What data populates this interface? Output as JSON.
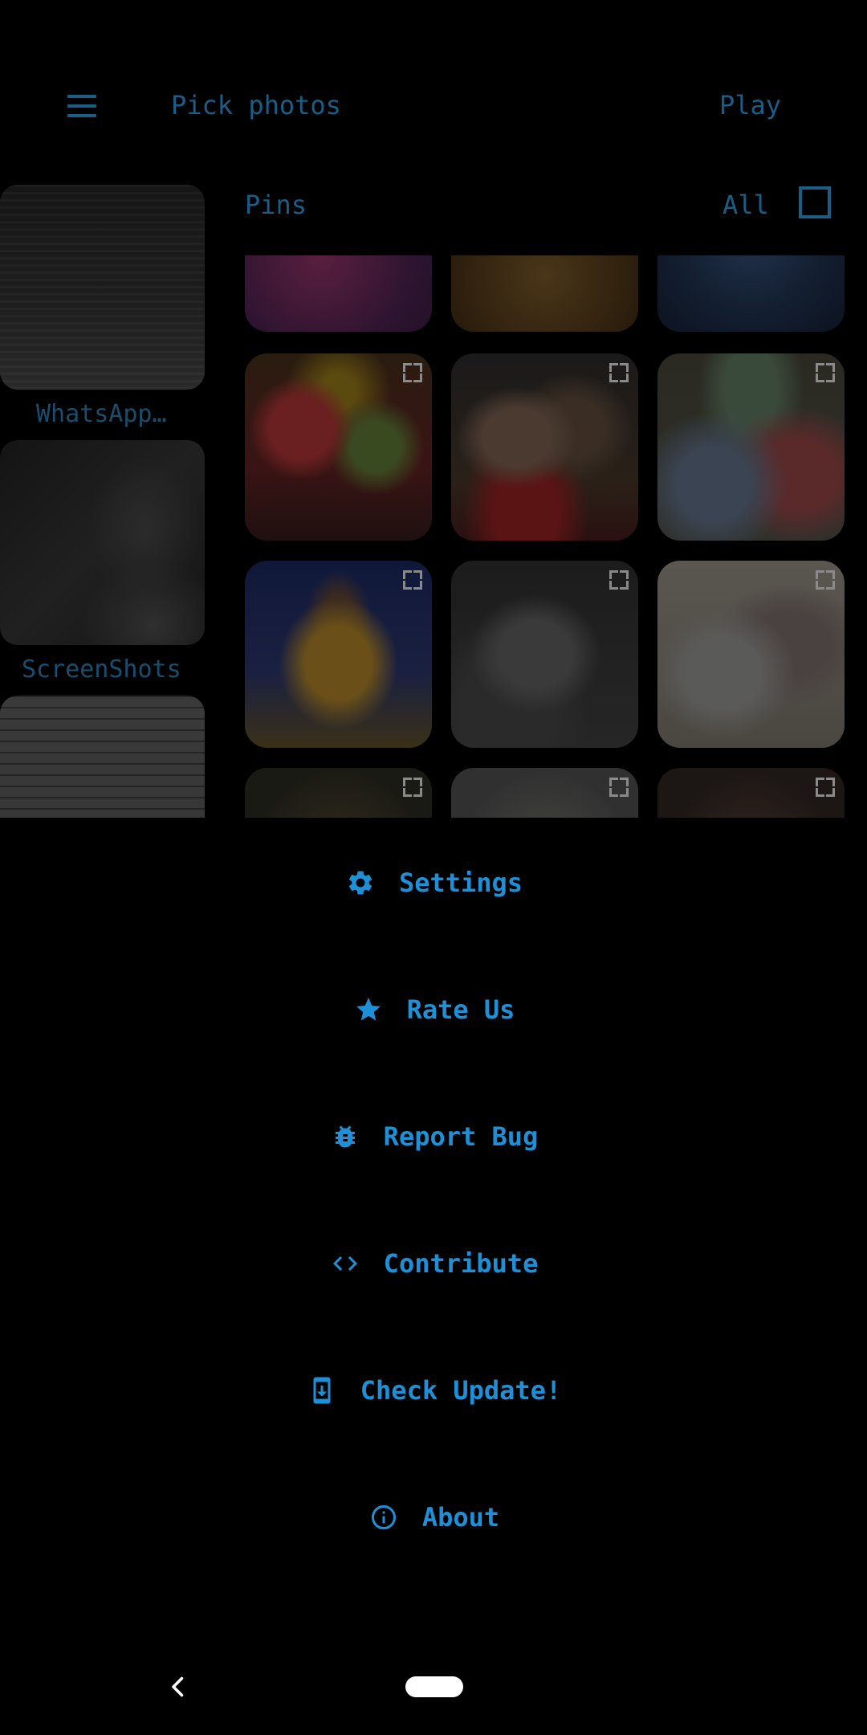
{
  "app_bar": {
    "title": "Pick photos",
    "play_label": "Play",
    "menu_icon": "hamburger-menu-icon"
  },
  "albums": [
    {
      "label": "WhatsApp…"
    },
    {
      "label": "ScreenShots"
    },
    {
      "label": ""
    }
  ],
  "pins": {
    "label": "Pins",
    "all_label": "All",
    "all_checked": false
  },
  "photos": {
    "expand_icon": "fullscreen-expand-icon",
    "count_visible": 12
  },
  "drawer_menu": {
    "items": [
      {
        "label": "Settings",
        "icon": "gear-icon"
      },
      {
        "label": "Rate Us",
        "icon": "star-icon"
      },
      {
        "label": "Report Bug",
        "icon": "bug-icon"
      },
      {
        "label": "Contribute",
        "icon": "code-icon"
      },
      {
        "label": "Check Update!",
        "icon": "phone-download-icon"
      },
      {
        "label": "About",
        "icon": "info-icon"
      }
    ]
  },
  "colors": {
    "background": "#000000",
    "accent": "#1e90d8",
    "dimmed_accent": "#1b5d86"
  },
  "nav_bar": {
    "back_icon": "back-chevron-icon",
    "home_icon": "home-pill-icon"
  }
}
